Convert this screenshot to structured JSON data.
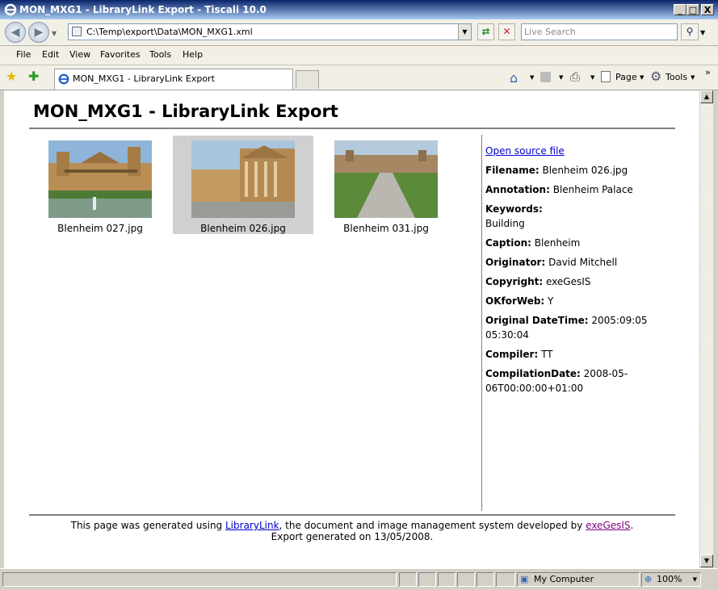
{
  "window": {
    "title": "MON_MXG1  - LibraryLink Export - Tiscali 10.0",
    "min_label": "_",
    "max_label": "□",
    "close_label": "X"
  },
  "address": {
    "url": "C:\\Temp\\export\\Data\\MON_MXG1.xml",
    "search_placeholder": "Live Search"
  },
  "menu": [
    "File",
    "Edit",
    "View",
    "Favorites",
    "Tools",
    "Help"
  ],
  "tab": {
    "title": "MON_MXG1  - LibraryLink Export"
  },
  "commands": {
    "page_label": "Page",
    "tools_label": "Tools"
  },
  "page": {
    "heading": "MON_MXG1  -  LibraryLink Export",
    "thumbnails": [
      {
        "caption": "Blenheim 027.jpg",
        "selected": false
      },
      {
        "caption": "Blenheim 026.jpg",
        "selected": true
      },
      {
        "caption": "Blenheim 031.jpg",
        "selected": false
      }
    ],
    "details": {
      "open_link": "Open source file",
      "filename_label": "Filename:",
      "filename_value": "Blenheim 026.jpg",
      "annotation_label": "Annotation:",
      "annotation_value": "Blenheim Palace",
      "keywords_label": "Keywords:",
      "keywords_value": "Building",
      "caption_label": "Caption:",
      "caption_value": "Blenheim",
      "originator_label": "Originator:",
      "originator_value": "David Mitchell",
      "copyright_label": "Copyright:",
      "copyright_value": "exeGesIS",
      "okforweb_label": "OKforWeb:",
      "okforweb_value": "Y",
      "datetime_label": "Original DateTime:",
      "datetime_value": "2005:09:05 05:30:04",
      "compiler_label": "Compiler:",
      "compiler_value": "TT",
      "compdate_label": "CompilationDate:",
      "compdate_value": "2008-05-06T00:00:00+01:00"
    },
    "footer": {
      "text_before": "This page was generated using ",
      "link1": "LibraryLink",
      "text_middle": ", the document and image management system developed by ",
      "link2": "exeGesIS",
      "text_after": ".",
      "line2": "Export generated on 13/05/2008."
    }
  },
  "status": {
    "zone": "My Computer",
    "zoom": "100%"
  }
}
